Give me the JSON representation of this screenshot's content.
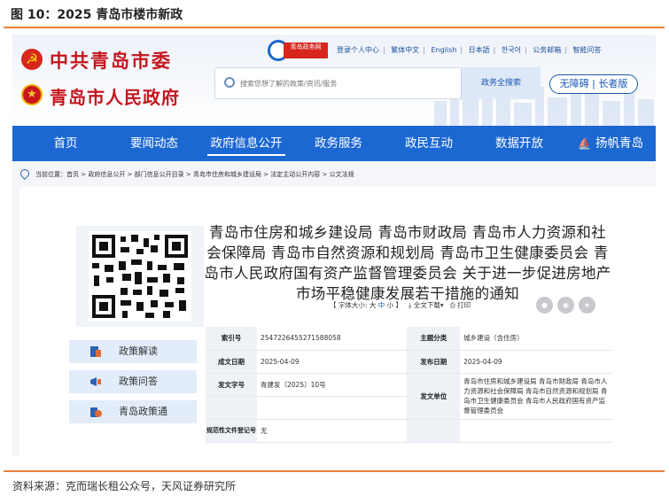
{
  "figure": {
    "caption": "图 10：2025 青岛市楼市新政",
    "source": "资料来源：克而瑞长租公众号，天风证券研究所"
  },
  "header": {
    "party_name": "中共青岛市委",
    "gov_name": "青岛市人民政府",
    "logo_text": "青岛政务网",
    "top_links": [
      "登录个人中心",
      "繁体中文",
      "English",
      "日本語",
      "한국어",
      "公务邮箱",
      "智能问答"
    ],
    "search": {
      "placeholder": "搜索您想了解的政策/资讯/服务",
      "button": "政务全搜索"
    },
    "accessibility": {
      "a": "无障碍",
      "b": "长者版"
    }
  },
  "nav": {
    "items": [
      "首页",
      "要闻动态",
      "政府信息公开",
      "政务服务",
      "政民互动",
      "数据开放",
      "扬帆青岛"
    ],
    "active_index": 2
  },
  "breadcrumb": {
    "text": "当前位置：首页 > 政府信息公开 > 部门信息公开目录 > 青岛市住房和城乡建设局 > 法定主动公开内容 > 公文法规"
  },
  "sidebar": {
    "items": [
      "政策解读",
      "政策问答",
      "青岛政策通"
    ]
  },
  "document": {
    "title": "青岛市住房和城乡建设局 青岛市财政局 青岛市人力资源和社会保障局 青岛市自然资源和规划局 青岛市卫生健康委员会 青岛市人民政府国有资产监督管理委员会 关于进一步促进房地产市场平稳健康发展若干措施的通知",
    "tools": {
      "font_size_label": "【 字体大小:",
      "font_large": "大",
      "font_medium": "中",
      "font_small": "小 】",
      "download": "全文下载",
      "print": "打印"
    },
    "info": {
      "index_label": "索引号",
      "index_value": "2547226455271588058",
      "topic_label": "主题分类",
      "topic_value": "城乡建设（含住房）",
      "date_label": "成文日期",
      "date_value": "2025-04-09",
      "publish_label": "发布日期",
      "publish_value": "2025-04-09",
      "docno_label": "发文字号",
      "docno_value": "青建发〔2025〕10号",
      "unit_label": "发文单位",
      "unit_value": "青岛市住房和城乡建设局 青岛市财政局 青岛市人力资源和社会保障局 青岛市自然资源和规划局 青岛市卫生健康委员会 青岛市人民政府国有资产监督管理委员会",
      "reg_label": "规范性文件登记号",
      "reg_value": "无"
    }
  },
  "colors": {
    "nav_blue": "#1c68d3",
    "brand_red": "#c5161e",
    "accent_orange": "#e9823a"
  }
}
